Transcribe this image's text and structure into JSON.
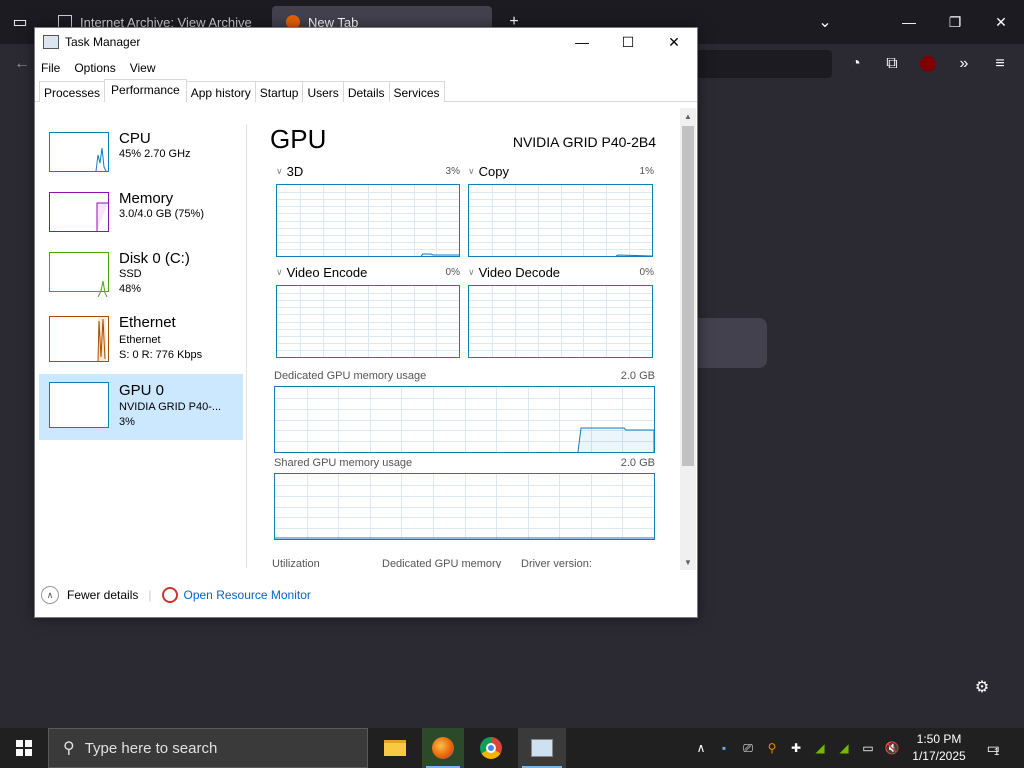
{
  "browser": {
    "tabs": [
      {
        "label": "Internet Archive: View Archive",
        "active": false
      },
      {
        "label": "New Tab",
        "active": true
      }
    ]
  },
  "task_manager": {
    "title": "Task Manager",
    "menu": [
      "File",
      "Options",
      "View"
    ],
    "tabs": [
      "Processes",
      "Performance",
      "App history",
      "Startup",
      "Users",
      "Details",
      "Services"
    ],
    "active_tab": "Performance",
    "sidebar": [
      {
        "name": "CPU",
        "line1": "45% 2.70 GHz",
        "line2": "",
        "color": "#117dbb"
      },
      {
        "name": "Memory",
        "line1": "3.0/4.0 GB (75%)",
        "line2": "",
        "color": "#8b12ae"
      },
      {
        "name": "Disk 0 (C:)",
        "line1": "SSD",
        "line2": "48%",
        "color": "#4da60c"
      },
      {
        "name": "Ethernet",
        "line1": "Ethernet",
        "line2": "S: 0 R: 776 Kbps",
        "color": "#a74f01"
      },
      {
        "name": "GPU 0",
        "line1": "NVIDIA GRID P40-...",
        "line2": "3%",
        "color": "#117dbb"
      }
    ],
    "gpu": {
      "title": "GPU",
      "model": "NVIDIA GRID P40-2B4",
      "engines": [
        {
          "label": "3D",
          "percent": "3%"
        },
        {
          "label": "Copy",
          "percent": "1%"
        },
        {
          "label": "Video Encode",
          "percent": "0%"
        },
        {
          "label": "Video Decode",
          "percent": "0%"
        }
      ],
      "dedicated_label": "Dedicated GPU memory usage",
      "dedicated_max": "2.0 GB",
      "shared_label": "Shared GPU memory usage",
      "shared_max": "2.0 GB",
      "stats": [
        "Utilization",
        "Dedicated GPU memory",
        "Driver version:"
      ]
    },
    "fewer_details": "Fewer details",
    "resource_monitor": "Open Resource Monitor"
  },
  "taskbar": {
    "search_placeholder": "Type here to search",
    "time": "1:50 PM",
    "date": "1/17/2025",
    "notification_count": "1"
  },
  "colors": {
    "accent": "#117dbb",
    "taskbar": "#202020",
    "selection": "#cce8ff"
  }
}
